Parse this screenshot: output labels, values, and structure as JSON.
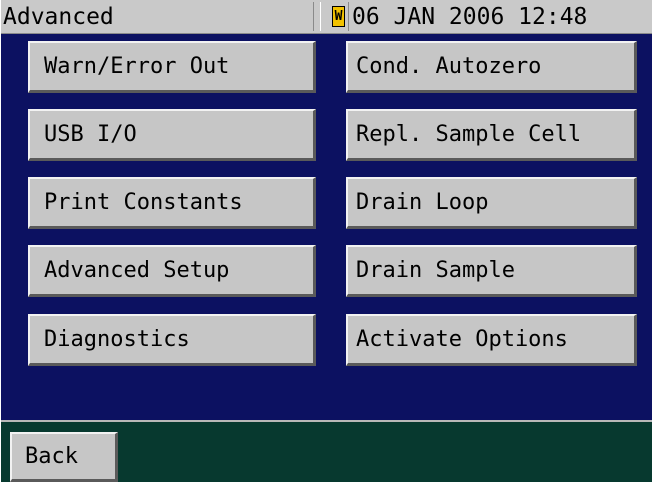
{
  "statusbar": {
    "title": "Advanced",
    "warning_icon": "W",
    "datetime": "06 JAN 2006 12:48"
  },
  "menu": {
    "left": [
      "Warn/Error Out",
      "USB I/O",
      "Print Constants",
      "Advanced Setup",
      "Diagnostics"
    ],
    "right": [
      "Cond. Autozero",
      "Repl. Sample Cell",
      "Drain Loop",
      "Drain Sample",
      "Activate Options"
    ]
  },
  "footer": {
    "back_label": "Back"
  },
  "colors": {
    "main_background": "#0c1161",
    "footer_background": "#07392f",
    "button_face": "#c6c6c6",
    "statusbar": "#c9c9c9",
    "warning_icon": "#f2c200"
  }
}
